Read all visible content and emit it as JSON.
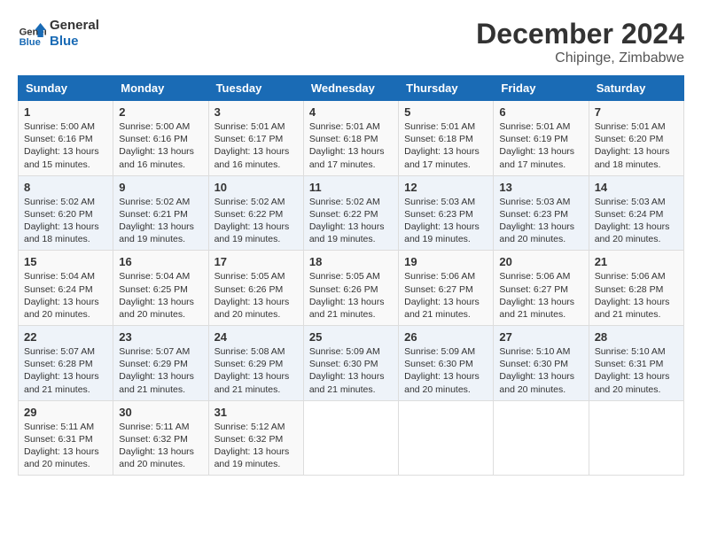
{
  "header": {
    "logo_line1": "General",
    "logo_line2": "Blue",
    "month_year": "December 2024",
    "location": "Chipinge, Zimbabwe"
  },
  "days_of_week": [
    "Sunday",
    "Monday",
    "Tuesday",
    "Wednesday",
    "Thursday",
    "Friday",
    "Saturday"
  ],
  "weeks": [
    [
      {
        "day": "1",
        "info": "Sunrise: 5:00 AM\nSunset: 6:16 PM\nDaylight: 13 hours\nand 15 minutes."
      },
      {
        "day": "2",
        "info": "Sunrise: 5:00 AM\nSunset: 6:16 PM\nDaylight: 13 hours\nand 16 minutes."
      },
      {
        "day": "3",
        "info": "Sunrise: 5:01 AM\nSunset: 6:17 PM\nDaylight: 13 hours\nand 16 minutes."
      },
      {
        "day": "4",
        "info": "Sunrise: 5:01 AM\nSunset: 6:18 PM\nDaylight: 13 hours\nand 17 minutes."
      },
      {
        "day": "5",
        "info": "Sunrise: 5:01 AM\nSunset: 6:18 PM\nDaylight: 13 hours\nand 17 minutes."
      },
      {
        "day": "6",
        "info": "Sunrise: 5:01 AM\nSunset: 6:19 PM\nDaylight: 13 hours\nand 17 minutes."
      },
      {
        "day": "7",
        "info": "Sunrise: 5:01 AM\nSunset: 6:20 PM\nDaylight: 13 hours\nand 18 minutes."
      }
    ],
    [
      {
        "day": "8",
        "info": "Sunrise: 5:02 AM\nSunset: 6:20 PM\nDaylight: 13 hours\nand 18 minutes."
      },
      {
        "day": "9",
        "info": "Sunrise: 5:02 AM\nSunset: 6:21 PM\nDaylight: 13 hours\nand 19 minutes."
      },
      {
        "day": "10",
        "info": "Sunrise: 5:02 AM\nSunset: 6:22 PM\nDaylight: 13 hours\nand 19 minutes."
      },
      {
        "day": "11",
        "info": "Sunrise: 5:02 AM\nSunset: 6:22 PM\nDaylight: 13 hours\nand 19 minutes."
      },
      {
        "day": "12",
        "info": "Sunrise: 5:03 AM\nSunset: 6:23 PM\nDaylight: 13 hours\nand 19 minutes."
      },
      {
        "day": "13",
        "info": "Sunrise: 5:03 AM\nSunset: 6:23 PM\nDaylight: 13 hours\nand 20 minutes."
      },
      {
        "day": "14",
        "info": "Sunrise: 5:03 AM\nSunset: 6:24 PM\nDaylight: 13 hours\nand 20 minutes."
      }
    ],
    [
      {
        "day": "15",
        "info": "Sunrise: 5:04 AM\nSunset: 6:24 PM\nDaylight: 13 hours\nand 20 minutes."
      },
      {
        "day": "16",
        "info": "Sunrise: 5:04 AM\nSunset: 6:25 PM\nDaylight: 13 hours\nand 20 minutes."
      },
      {
        "day": "17",
        "info": "Sunrise: 5:05 AM\nSunset: 6:26 PM\nDaylight: 13 hours\nand 20 minutes."
      },
      {
        "day": "18",
        "info": "Sunrise: 5:05 AM\nSunset: 6:26 PM\nDaylight: 13 hours\nand 21 minutes."
      },
      {
        "day": "19",
        "info": "Sunrise: 5:06 AM\nSunset: 6:27 PM\nDaylight: 13 hours\nand 21 minutes."
      },
      {
        "day": "20",
        "info": "Sunrise: 5:06 AM\nSunset: 6:27 PM\nDaylight: 13 hours\nand 21 minutes."
      },
      {
        "day": "21",
        "info": "Sunrise: 5:06 AM\nSunset: 6:28 PM\nDaylight: 13 hours\nand 21 minutes."
      }
    ],
    [
      {
        "day": "22",
        "info": "Sunrise: 5:07 AM\nSunset: 6:28 PM\nDaylight: 13 hours\nand 21 minutes."
      },
      {
        "day": "23",
        "info": "Sunrise: 5:07 AM\nSunset: 6:29 PM\nDaylight: 13 hours\nand 21 minutes."
      },
      {
        "day": "24",
        "info": "Sunrise: 5:08 AM\nSunset: 6:29 PM\nDaylight: 13 hours\nand 21 minutes."
      },
      {
        "day": "25",
        "info": "Sunrise: 5:09 AM\nSunset: 6:30 PM\nDaylight: 13 hours\nand 21 minutes."
      },
      {
        "day": "26",
        "info": "Sunrise: 5:09 AM\nSunset: 6:30 PM\nDaylight: 13 hours\nand 20 minutes."
      },
      {
        "day": "27",
        "info": "Sunrise: 5:10 AM\nSunset: 6:30 PM\nDaylight: 13 hours\nand 20 minutes."
      },
      {
        "day": "28",
        "info": "Sunrise: 5:10 AM\nSunset: 6:31 PM\nDaylight: 13 hours\nand 20 minutes."
      }
    ],
    [
      {
        "day": "29",
        "info": "Sunrise: 5:11 AM\nSunset: 6:31 PM\nDaylight: 13 hours\nand 20 minutes."
      },
      {
        "day": "30",
        "info": "Sunrise: 5:11 AM\nSunset: 6:32 PM\nDaylight: 13 hours\nand 20 minutes."
      },
      {
        "day": "31",
        "info": "Sunrise: 5:12 AM\nSunset: 6:32 PM\nDaylight: 13 hours\nand 19 minutes."
      },
      null,
      null,
      null,
      null
    ]
  ]
}
